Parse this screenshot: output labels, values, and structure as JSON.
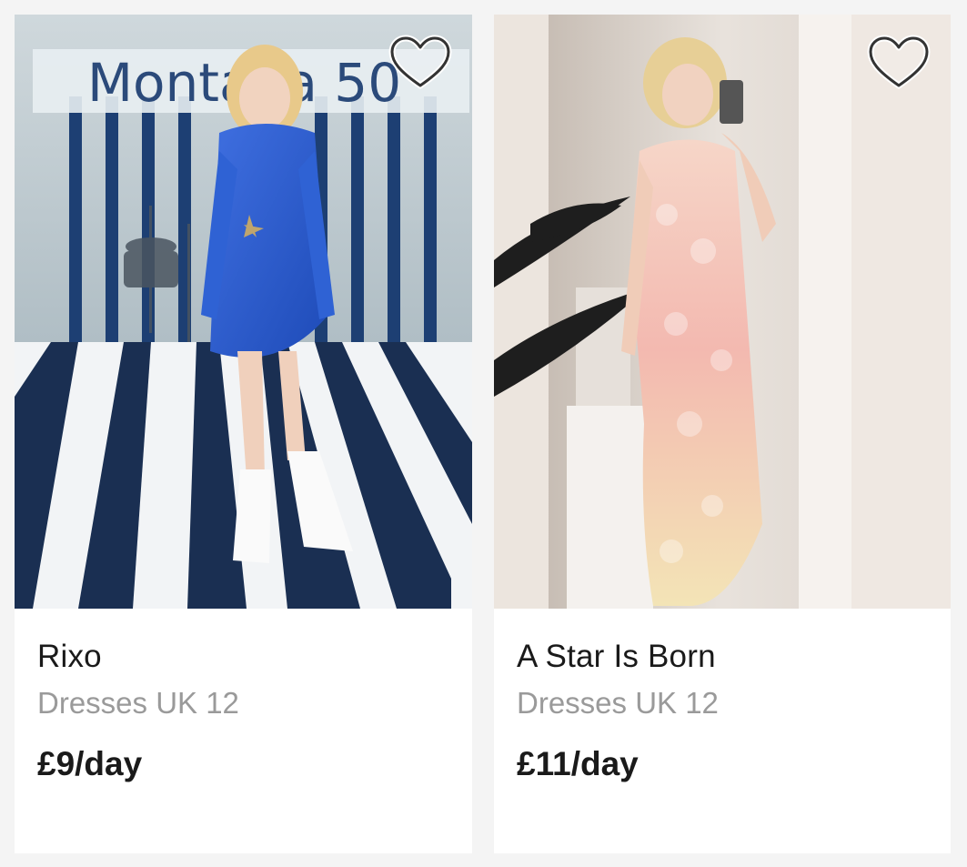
{
  "listings": [
    {
      "name": "Rixo",
      "category": "Dresses UK 12",
      "price": "£9/day",
      "photo_sign_text": "Montana 50",
      "favorite_icon": "heart-outline-icon",
      "favorited": false
    },
    {
      "name": "A Star Is Born",
      "category": "Dresses UK 12",
      "price": "£11/day",
      "favorite_icon": "heart-outline-icon",
      "favorited": false
    }
  ],
  "colors": {
    "background": "#f4f4f4",
    "card": "#ffffff",
    "title": "#1a1a1a",
    "subtitle": "#9a9a9a"
  }
}
